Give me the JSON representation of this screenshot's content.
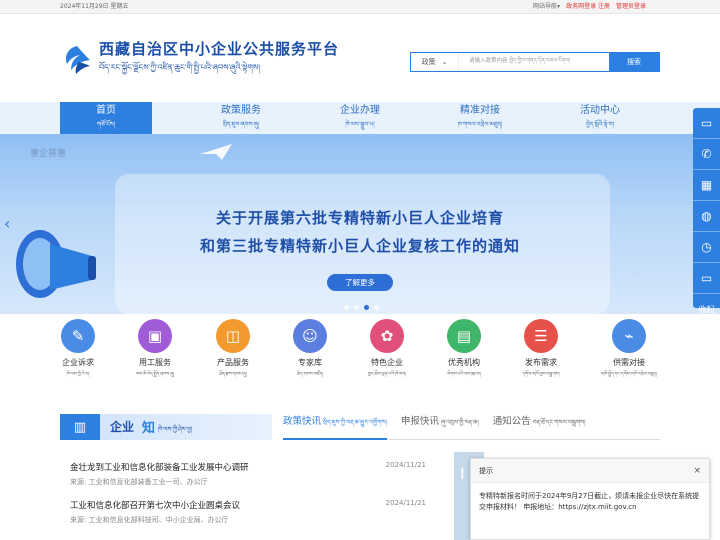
{
  "topbar": {
    "date": "2024年11月29日 星期五",
    "site_nav": "网站导航▾",
    "login": "政务网登录 注册",
    "admin": "管理员登录"
  },
  "header": {
    "title": "西藏自治区中小企业公共服务平台",
    "subtitle": "བོད་རང་སྐྱོང་ལྗོངས་ཀྱི་འཛིན་ཆུང་གི་སྤྱི་པའི་ཞབས་ཞུའི་སྟེགས།"
  },
  "search": {
    "category": "政策",
    "placeholder": "请输入政策内容 ཁྱེད་ཀྱིས་གནད་དོན་བཙལ་རོགས།",
    "button": "搜索"
  },
  "nav": [
    {
      "zh": "首页",
      "bo": "གཙོ་ངོས།"
    },
    {
      "zh": "政策服务",
      "bo": "སྲིད་ཇུས་ཞབས་ཞུ།"
    },
    {
      "zh": "企业办理",
      "bo": "ཁེ་ལས་སྒྲུབ་པ།"
    },
    {
      "zh": "精准对接",
      "bo": "ཁ་གསལ་འབྲེལ་མཐུད།"
    },
    {
      "zh": "活动中心",
      "bo": "བྱེད་སྒོའི་ལྟེ་བ།"
    }
  ],
  "banner": {
    "watermark": "惠企普惠",
    "line1": "关于开展第六批专精特新小巨人企业培育",
    "line2": "和第三批专精特新小巨人企业复核工作的通知",
    "more": "了解更多"
  },
  "services": [
    {
      "zh": "企业诉求",
      "bo": "ཁེ་ལས་ཀྱི་རེ་བ།",
      "color": "#4a8be6"
    },
    {
      "zh": "用工服务",
      "bo": "ལས་མི་བེད་སྤྱོད་ཞབས་ཞུ།",
      "color": "#a05bd6"
    },
    {
      "zh": "产品服务",
      "bo": "ཐོན་རྫས་ཞབས་ཞུ།",
      "color": "#f29a2e"
    },
    {
      "zh": "专家库",
      "bo": "ཆེད་མཁས་མཛོད།",
      "color": "#5b7fe0"
    },
    {
      "zh": "特色企业",
      "bo": "ཁྱད་ཆོས་ལྡན་པའི་ཁེ་ལས།",
      "color": "#e0507a"
    },
    {
      "zh": "优秀机构",
      "bo": "ལེགས་པའི་ལས་ཁུངས།",
      "color": "#3fb56a"
    },
    {
      "zh": "发布需求",
      "bo": "དགོས་མཁོ་ཁྱབ་བསྒྲགས།",
      "color": "#e6514a"
    },
    {
      "zh": "供需对接",
      "bo": "མཁོ་སྤྲོད་དང་དགོས་མཁོ་འབྲེལ་མཐུད།",
      "color": "#4a8be6"
    }
  ],
  "news_head": {
    "t1": "企业",
    "t2": "知",
    "t3": "ཁེ་ལས་ཀྱི་ཤེས་བྱ།"
  },
  "tabs": [
    {
      "zh": "政策快讯",
      "bo": "སྲིད་ཇུས་ཀྱི་བརྡ་ཆ་མྱུར་འགྱོགས།"
    },
    {
      "zh": "申报快讯",
      "bo": "ཞུ་འབུལ་གྱི་བརྡ་ཆ།"
    },
    {
      "zh": "通知公告",
      "bo": "བརྡ་ཐོ་དང་གསལ་བསྒྲགས།"
    }
  ],
  "news": [
    {
      "title": "金壮龙到工业和信息化部装备工业发展中心调研",
      "source": "来源: 工业和信息化部装备工业一司、办公厅",
      "date": "2024/11/21"
    },
    {
      "title": "工业和信息化部召开第七次中小企业圆桌会议",
      "source": "来源: 工业和信息化部科技司、中小企业局、办公厅",
      "date": "2024/11/21"
    }
  ],
  "dialog": {
    "title": "提示",
    "close": "×",
    "body": "专精特新报名时间于2024年9月27日截止，烦请未报企业尽快在系统提交申报材料！ 申报地址：https://zjtx.miit.gov.cn"
  },
  "float": {
    "collapse": "收起"
  }
}
